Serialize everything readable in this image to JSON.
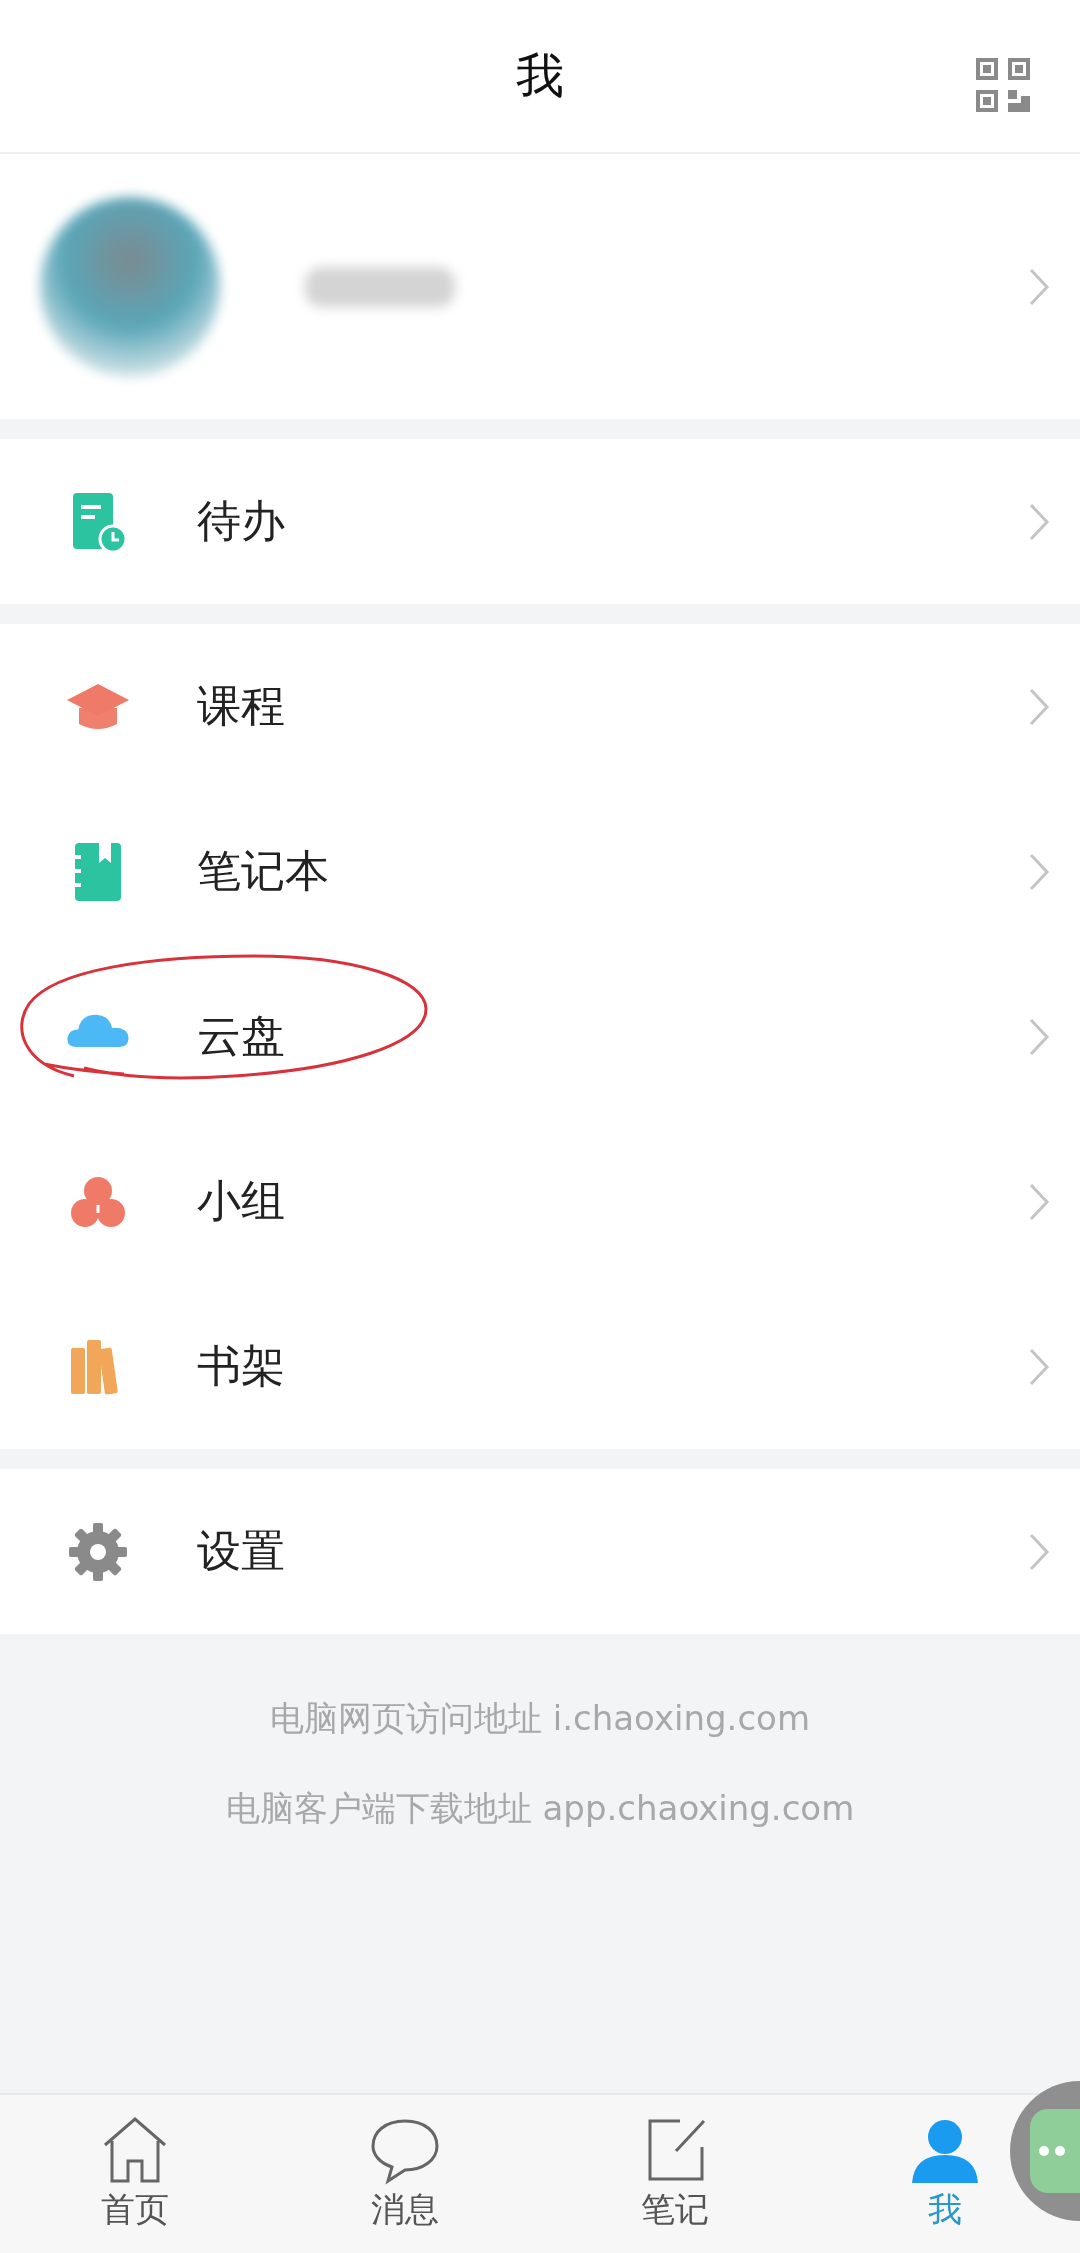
{
  "header": {
    "title": "我"
  },
  "profile": {
    "kind": "blurred"
  },
  "sections": [
    {
      "items": [
        {
          "kind": "todo",
          "label": "待办",
          "circled": false
        }
      ]
    },
    {
      "items": [
        {
          "kind": "course",
          "label": "课程",
          "circled": false
        },
        {
          "kind": "notebook",
          "label": "笔记本",
          "circled": false
        },
        {
          "kind": "cloud",
          "label": "云盘",
          "circled": true
        },
        {
          "kind": "group",
          "label": "小组",
          "circled": false
        },
        {
          "kind": "shelf",
          "label": "书架",
          "circled": false
        }
      ]
    },
    {
      "items": [
        {
          "kind": "settings",
          "label": "设置",
          "circled": false
        }
      ]
    }
  ],
  "footer": [
    "电脑网页访问地址 i.chaoxing.com",
    "电脑客户端下载地址 app.chaoxing.com"
  ],
  "tabs": [
    {
      "kind": "home",
      "label": "首页",
      "selected": false
    },
    {
      "kind": "message",
      "label": "消息",
      "selected": false
    },
    {
      "kind": "note",
      "label": "笔记",
      "selected": false
    },
    {
      "kind": "me",
      "label": "我",
      "selected": true
    }
  ]
}
